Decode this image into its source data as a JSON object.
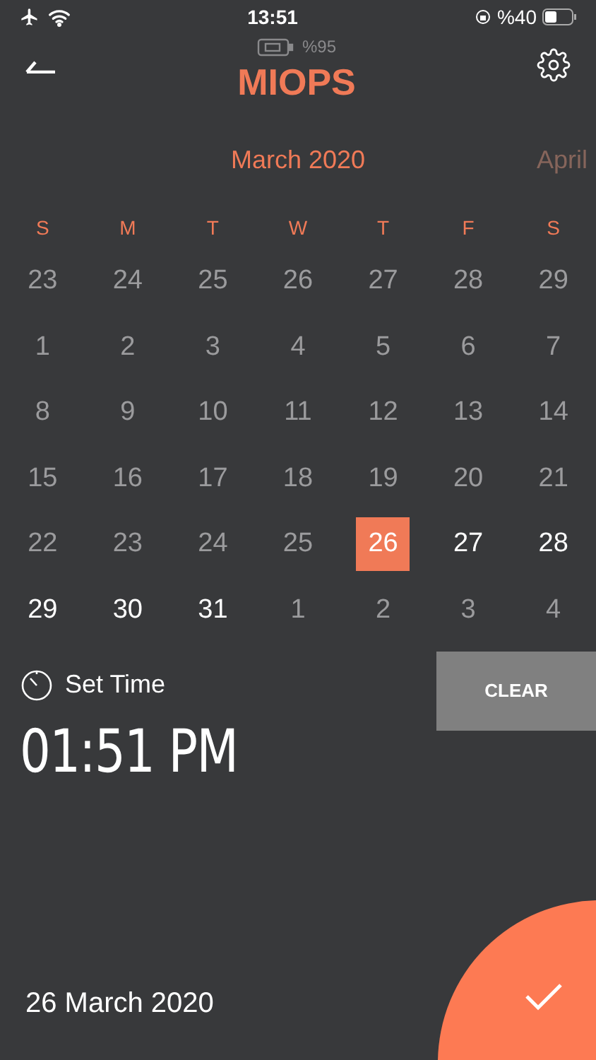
{
  "status_bar": {
    "time": "13:51",
    "battery": "%40"
  },
  "header": {
    "device_battery": "%95",
    "title": "MIOPS"
  },
  "months": [
    {
      "label": "March 2020",
      "selected": true
    },
    {
      "label": "April",
      "selected": false
    }
  ],
  "weekdays": [
    "S",
    "M",
    "T",
    "W",
    "T",
    "F",
    "S"
  ],
  "days": [
    {
      "label": "23",
      "kind": "dim",
      "selected": false
    },
    {
      "label": "24",
      "kind": "dim",
      "selected": false
    },
    {
      "label": "25",
      "kind": "dim",
      "selected": false
    },
    {
      "label": "26",
      "kind": "dim",
      "selected": false
    },
    {
      "label": "27",
      "kind": "dim",
      "selected": false
    },
    {
      "label": "28",
      "kind": "dim",
      "selected": false
    },
    {
      "label": "29",
      "kind": "dim",
      "selected": false
    },
    {
      "label": "1",
      "kind": "dim",
      "selected": false
    },
    {
      "label": "2",
      "kind": "dim",
      "selected": false
    },
    {
      "label": "3",
      "kind": "dim",
      "selected": false
    },
    {
      "label": "4",
      "kind": "dim",
      "selected": false
    },
    {
      "label": "5",
      "kind": "dim",
      "selected": false
    },
    {
      "label": "6",
      "kind": "dim",
      "selected": false
    },
    {
      "label": "7",
      "kind": "dim",
      "selected": false
    },
    {
      "label": "8",
      "kind": "dim",
      "selected": false
    },
    {
      "label": "9",
      "kind": "dim",
      "selected": false
    },
    {
      "label": "10",
      "kind": "dim",
      "selected": false
    },
    {
      "label": "11",
      "kind": "dim",
      "selected": false
    },
    {
      "label": "12",
      "kind": "dim",
      "selected": false
    },
    {
      "label": "13",
      "kind": "dim",
      "selected": false
    },
    {
      "label": "14",
      "kind": "dim",
      "selected": false
    },
    {
      "label": "15",
      "kind": "dim",
      "selected": false
    },
    {
      "label": "16",
      "kind": "dim",
      "selected": false
    },
    {
      "label": "17",
      "kind": "dim",
      "selected": false
    },
    {
      "label": "18",
      "kind": "dim",
      "selected": false
    },
    {
      "label": "19",
      "kind": "dim",
      "selected": false
    },
    {
      "label": "20",
      "kind": "dim",
      "selected": false
    },
    {
      "label": "21",
      "kind": "dim",
      "selected": false
    },
    {
      "label": "22",
      "kind": "dim",
      "selected": false
    },
    {
      "label": "23",
      "kind": "dim",
      "selected": false
    },
    {
      "label": "24",
      "kind": "dim",
      "selected": false
    },
    {
      "label": "25",
      "kind": "dim",
      "selected": false
    },
    {
      "label": "26",
      "kind": "bright",
      "selected": true
    },
    {
      "label": "27",
      "kind": "bright",
      "selected": false
    },
    {
      "label": "28",
      "kind": "bright",
      "selected": false
    },
    {
      "label": "29",
      "kind": "bright",
      "selected": false
    },
    {
      "label": "30",
      "kind": "bright",
      "selected": false
    },
    {
      "label": "31",
      "kind": "bright",
      "selected": false
    },
    {
      "label": "1",
      "kind": "dim",
      "selected": false
    },
    {
      "label": "2",
      "kind": "dim",
      "selected": false
    },
    {
      "label": "3",
      "kind": "dim",
      "selected": false
    },
    {
      "label": "4",
      "kind": "dim",
      "selected": false
    }
  ],
  "set_time": {
    "label": "Set Time",
    "value": "01:51 PM"
  },
  "clear_button": "CLEAR",
  "selected_date": "26 March 2020"
}
